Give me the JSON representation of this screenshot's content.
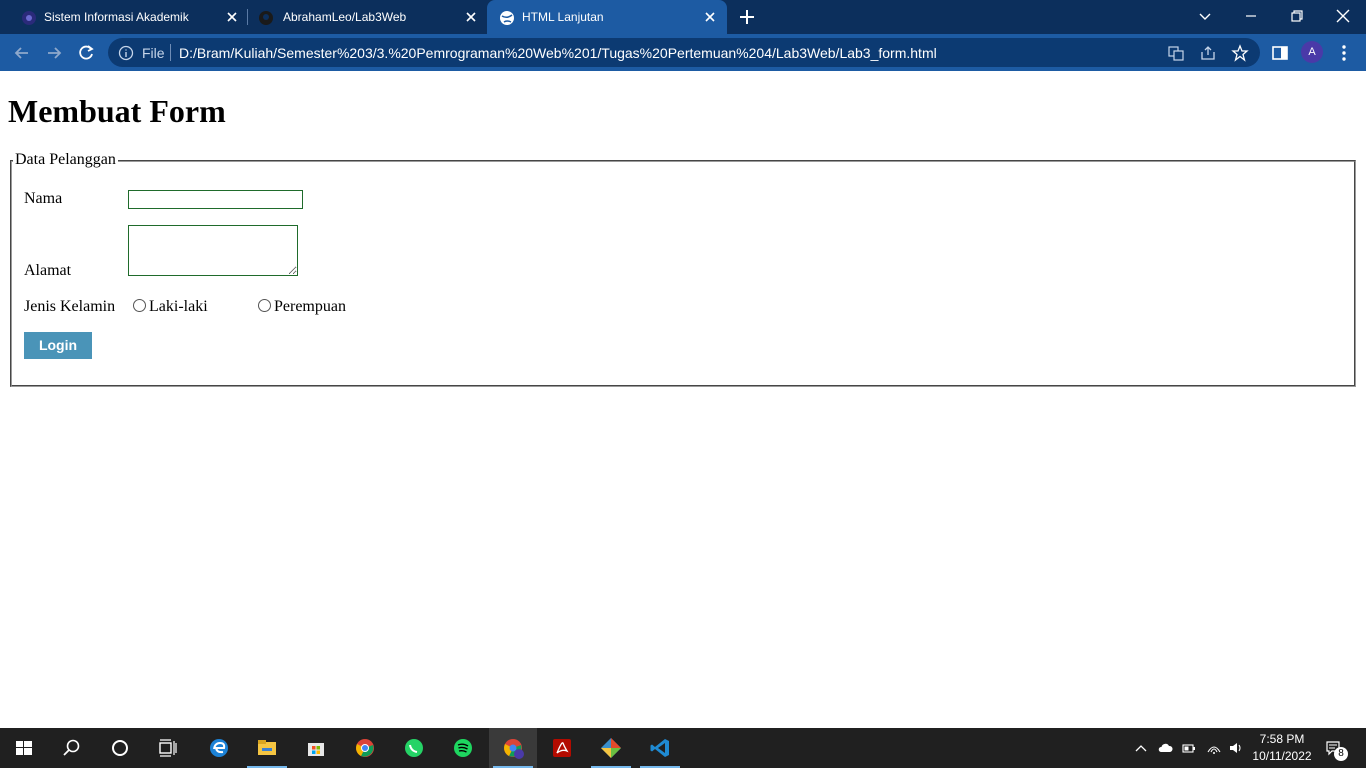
{
  "browser": {
    "tabs": [
      {
        "title": "Sistem Informasi Akademik",
        "active": false
      },
      {
        "title": "AbrahamLeo/Lab3Web",
        "active": false
      },
      {
        "title": "HTML Lanjutan",
        "active": true
      }
    ],
    "address": {
      "scheme_label": "File",
      "url": "D:/Bram/Kuliah/Semester%203/3.%20Pemrograman%20Web%201/Tugas%20Pertemuan%204/Lab3Web/Lab3_form.html"
    },
    "profile_initial": "A",
    "colors": {
      "tabstrip": "#0c2f5c",
      "toolbar": "#1d5ba3",
      "omnibox": "#0c3a72"
    }
  },
  "page": {
    "heading": "Membuat Form",
    "fieldset_legend": "Data Pelanggan",
    "nama_label": "Nama",
    "nama_value": "",
    "alamat_label": "Alamat",
    "alamat_value": "",
    "gender_label": "Jenis Kelamin",
    "gender_options": [
      "Laki-laki",
      "Perempuan"
    ],
    "gender_selected": null,
    "submit_label": "Login",
    "colors": {
      "button": "#4a94b8",
      "input_border": "#1f6b2b"
    }
  },
  "taskbar": {
    "apps": [
      "start-icon",
      "search-icon",
      "cortana-icon",
      "task-view-icon",
      "edge-icon",
      "file-explorer-icon",
      "microsoft-store-icon",
      "chrome-icon",
      "whatsapp-icon",
      "spotify-icon",
      "chrome-profile-icon",
      "acrobat-icon",
      "git-icon",
      "vscode-icon"
    ],
    "time": "7:58 PM",
    "date": "10/11/2022",
    "notification_count": "8"
  }
}
